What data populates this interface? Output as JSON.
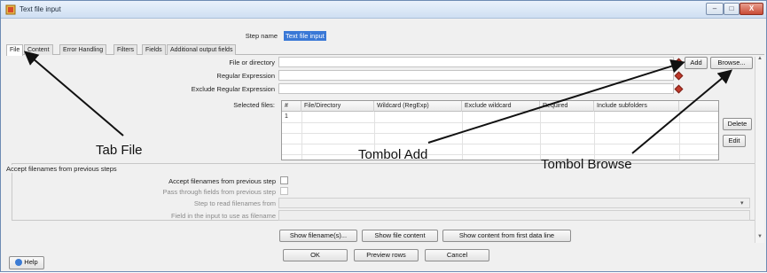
{
  "window": {
    "title": "Text file input",
    "buttons": {
      "minimize": "–",
      "maximize": "□",
      "close": "X"
    }
  },
  "step": {
    "label": "Step name",
    "value": "Text file input"
  },
  "tabs": [
    {
      "label": "File",
      "active": true
    },
    {
      "label": "Content"
    },
    {
      "label": "Error Handling"
    },
    {
      "label": "Filters"
    },
    {
      "label": "Fields"
    },
    {
      "label": "Additional output fields"
    }
  ],
  "file_tab": {
    "file_or_directory": {
      "label": "File or directory",
      "value": ""
    },
    "regex": {
      "label": "Regular Expression",
      "value": ""
    },
    "exclude_regex": {
      "label": "Exclude Regular Expression",
      "value": ""
    },
    "add_button": "Add",
    "browse_button": "Browse...",
    "selected_files": {
      "label": "Selected files:",
      "columns": [
        "#",
        "File/Directory",
        "Wildcard (RegExp)",
        "Exclude wildcard",
        "Required",
        "Include subfolders"
      ],
      "rows": [
        [
          "1",
          "",
          "",
          "",
          "",
          ""
        ]
      ]
    },
    "delete_button": "Delete",
    "edit_button": "Edit"
  },
  "accept_group": {
    "title": "Accept filenames from previous steps",
    "accept_label": "Accept filenames from previous step",
    "pass_through_label": "Pass through fields from previous step",
    "step_to_read_label": "Step to read filenames from",
    "field_label": "Field in the input to use as filename"
  },
  "bottom_buttons": {
    "show_filenames": "Show filename(s)...",
    "show_file_content": "Show file content",
    "show_content_first_line": "Show content from first data line"
  },
  "dialog_buttons": {
    "ok": "OK",
    "preview": "Preview rows",
    "cancel": "Cancel",
    "help": "Help"
  },
  "annotations": {
    "tab_file": "Tab File",
    "tombol_add": "Tombol Add",
    "tombol_browse": "Tombol Browse"
  },
  "colors": {
    "accent": "#3a78d6",
    "marker": "#c0392b",
    "close": "#c94a35"
  },
  "icons": {
    "title": "spoon-icon",
    "marker": "diamond-marker-icon",
    "help": "help-icon"
  }
}
